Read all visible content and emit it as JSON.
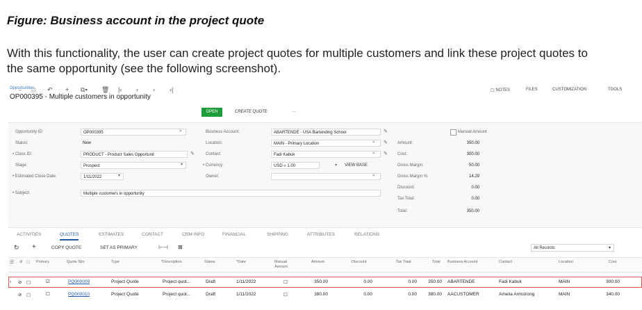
{
  "figure_caption": "Figure: Business account in the project quote",
  "intro_lines": [
    "With this functionality, the user can create project quotes for multiple customers and link these project quotes to",
    "the same opportunity (see the following screenshot)."
  ],
  "screen": {
    "breadcrumb": "Opportunities",
    "record_title": "OP000395 - Multiple customers in opportunity",
    "top_nav": [
      "NOTES",
      "FILES",
      "CUSTOMIZATION",
      "TOOLS"
    ],
    "toolbar": {
      "open_label": "OPEN",
      "create_quote_label": "CREATE QUOTE",
      "more_label": "···"
    },
    "form": {
      "opportunity_id": {
        "label": "Opportunity ID:",
        "value": "OP000395"
      },
      "status": {
        "label": "Status:",
        "value": "New"
      },
      "class_id": {
        "label": "• Class ID:",
        "value": "PRODUCT - Product Sales Opportunit"
      },
      "stage": {
        "label": "Stage:",
        "value": "Prospect"
      },
      "est_close_date": {
        "label": "• Estimated Close Date:",
        "value": "1/11/2022"
      },
      "subject": {
        "label": "• Subject:",
        "value": "Multiple customers in opportunity"
      },
      "business_account": {
        "label": "Business Account:",
        "value": "ABARTENDE - USA Bartending School"
      },
      "location": {
        "label": "Location:",
        "value": "MAIN - Primary Location"
      },
      "contact": {
        "label": "Contact:",
        "value": "Fadi Kabuk"
      },
      "currency": {
        "label": "• Currency:",
        "value": "USD",
        "rate": "1.00",
        "view_base": "VIEW BASE"
      },
      "owner": {
        "label": "Owner:",
        "value": ""
      },
      "manual_amount_label": "Manual Amount",
      "totals": [
        {
          "label": "Amount:",
          "value": "350.00"
        },
        {
          "label": "Cost:",
          "value": "300.00"
        },
        {
          "label": "Gross Margin:",
          "value": "50.00"
        },
        {
          "label": "Gross Margin %:",
          "value": "14.29"
        },
        {
          "label": "Discount:",
          "value": "0.00"
        },
        {
          "label": "Tax Total:",
          "value": "0.00"
        },
        {
          "label": "Total:",
          "value": "350.00"
        }
      ]
    },
    "tabs": [
      "ACTIVITIES",
      "QUOTES",
      "ESTIMATES",
      "CONTACT",
      "CRM INFO",
      "FINANCIAL",
      "SHIPPING",
      "ATTRIBUTES",
      "RELATIONS"
    ],
    "active_tab": "QUOTES",
    "grid_toolbar": {
      "copy_quote": "COPY QUOTE",
      "set_primary": "SET AS PRIMARY",
      "records_filter": "All Records"
    },
    "grid_columns": [
      "Primary",
      "Quote Nbr.",
      "Type",
      "*Description",
      "Status",
      "*Date",
      "Manual Amount",
      "Amount",
      "Discount",
      "Tax Total",
      "Total",
      "Business Account",
      "Contact",
      "Location",
      "Cost"
    ],
    "grid_rows": [
      {
        "quote_nbr": "PQ000009",
        "type": "Project Quote",
        "description": "Project quot...",
        "status": "Draft",
        "date": "1/11/2022",
        "amount": "350.00",
        "discount": "0.00",
        "tax_total": "0.00",
        "total": "350.00",
        "business_account": "ABARTENDE",
        "contact": "Fadi Kabuk",
        "location": "MAIN",
        "cost": "300.00"
      },
      {
        "quote_nbr": "PQ000010",
        "type": "Project Quote",
        "description": "Project quot...",
        "status": "Draft",
        "date": "1/11/2022",
        "amount": "380.00",
        "discount": "0.00",
        "tax_total": "0.00",
        "total": "380.00",
        "business_account": "AACUSTOMER",
        "contact": "Amelia Armstrong",
        "location": "MAIN",
        "cost": "340.00"
      }
    ]
  }
}
